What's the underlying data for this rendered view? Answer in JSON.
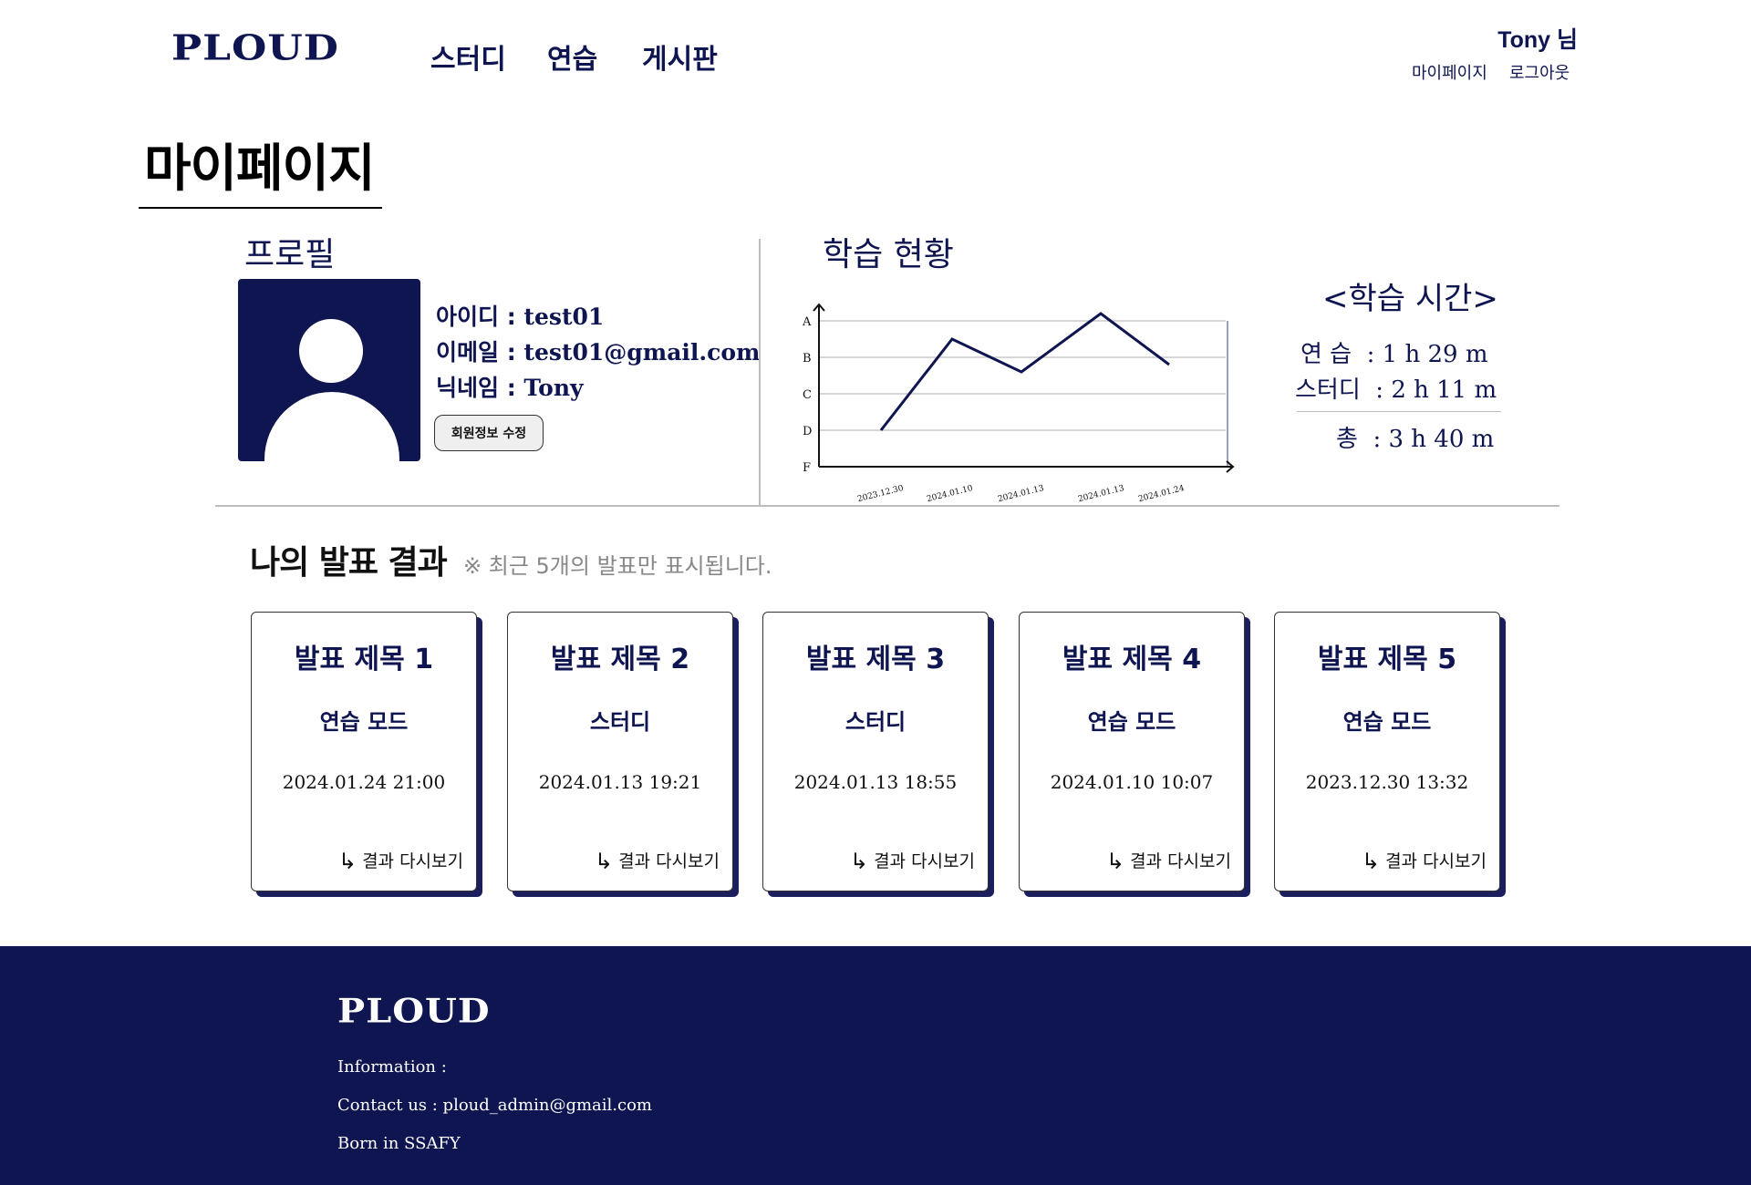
{
  "header": {
    "logo": "PLOUD",
    "nav": [
      "스터디",
      "연습",
      "게시판"
    ],
    "user_name": "Tony 님",
    "links": [
      "마이페이지",
      "로그아웃"
    ]
  },
  "page_title": "마이페이지",
  "profile": {
    "heading": "프로필",
    "id_label": "아이디 :",
    "id_value": "test01",
    "email_label": "이메일 :",
    "email_value": "test01@gmail.com",
    "nick_label": "닉네임 :",
    "nick_value": "Tony",
    "edit_button": "회원정보 수정"
  },
  "progress": {
    "heading": "학습 현황"
  },
  "chart_data": {
    "type": "line",
    "title": "",
    "xlabel": "",
    "ylabel": "",
    "categories": [
      "2023.12.30",
      "2024.01.10",
      "2024.01.13",
      "2024.01.13",
      "2024.01.24"
    ],
    "y_levels": [
      "A",
      "B",
      "C",
      "D",
      "F"
    ],
    "series": [
      {
        "values": [
          "D",
          "B+",
          "B-",
          "A+",
          "B-"
        ]
      }
    ],
    "values_numeric": [
      1.0,
      3.5,
      2.6,
      4.2,
      2.8
    ],
    "grid": true,
    "color": "#0e1550"
  },
  "study_time": {
    "title": "<학습 시간>",
    "practice_label": "연 습",
    "practice_value": ": 1 h  29 m",
    "study_label": "스터디",
    "study_value": ": 2 h  11  m",
    "total_label": "총",
    "total_value": ": 3 h  40 m"
  },
  "results": {
    "heading": "나의 발표 결과",
    "note": "※ 최근 5개의 발표만 표시됩니다.",
    "link_label": "결과 다시보기",
    "cards": [
      {
        "title": "발표 제목 1",
        "mode": "연습 모드",
        "date": "2024.01.24  21:00"
      },
      {
        "title": "발표 제목 2",
        "mode": "스터디",
        "date": "2024.01.13  19:21"
      },
      {
        "title": "발표 제목 3",
        "mode": "스터디",
        "date": "2024.01.13  18:55"
      },
      {
        "title": "발표 제목 4",
        "mode": "연습 모드",
        "date": "2024.01.10  10:07"
      },
      {
        "title": "발표 제목 5",
        "mode": "연습 모드",
        "date": "2023.12.30   13:32"
      }
    ]
  },
  "footer": {
    "logo": "PLOUD",
    "info": "Information :",
    "contact": "Contact us :  ploud_admin@gmail.com",
    "born": "Born in SSAFY"
  }
}
